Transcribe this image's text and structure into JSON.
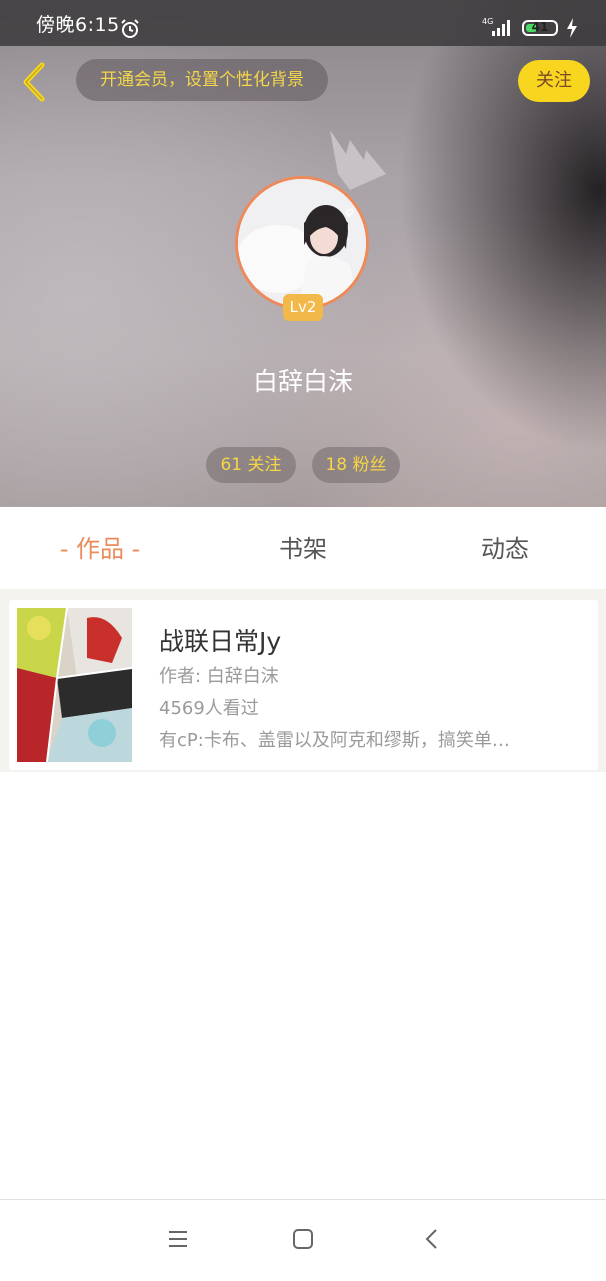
{
  "status_bar": {
    "time": "傍晚6:15",
    "network": "4G",
    "battery": "41",
    "battery_level": 0.41
  },
  "header": {
    "vip_prompt": "开通会员，设置个性化背景",
    "follow_label": "关注"
  },
  "profile": {
    "level": "Lv2",
    "username": "白辞白沫",
    "following": "61 关注",
    "fans": "18 粉丝"
  },
  "tabs": {
    "works": "- 作品 -",
    "shelf": "书架",
    "feed": "动态"
  },
  "book": {
    "title": "战联日常Jy",
    "author": "作者: 白辞白沫",
    "views": "4569人看过",
    "description": "有cP:卡布、盖雷以及阿克和缪斯，搞笑单…"
  },
  "colors": {
    "accent_orange": "#ec8b5a",
    "follow_yellow": "#f8d51f",
    "stat_text": "#f6d645",
    "level_badge": "#f2b84a"
  },
  "icons": [
    "back-arrow-icon",
    "alarm-icon",
    "signal-icon",
    "battery-icon",
    "charging-icon",
    "crown-icon",
    "menu-icon",
    "home-icon",
    "nav-back-icon"
  ]
}
